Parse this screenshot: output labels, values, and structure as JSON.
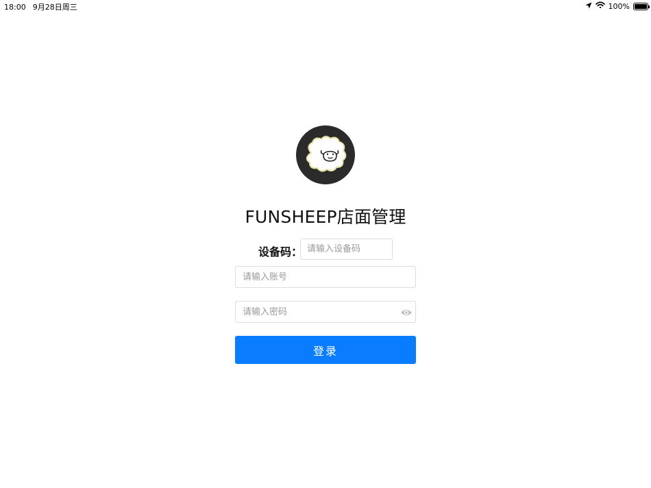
{
  "status_bar": {
    "time": "18:00",
    "date": "9月28日周三",
    "battery_text": "100%",
    "battery_level": 1.0,
    "icons": [
      "location-arrow-icon",
      "wifi-icon",
      "battery-icon"
    ]
  },
  "logo": {
    "icon": "sheep-logo-icon",
    "background_color": "#2b2b2b"
  },
  "title": "FUNSHEEP店面管理",
  "form": {
    "device_code_label": "设备码：",
    "device_code_placeholder": "请输入设备码",
    "device_code_value": "",
    "account_placeholder": "请输入账号",
    "account_value": "",
    "password_placeholder": "请输入密码",
    "password_value": "",
    "password_toggle_icon": "eye-icon",
    "login_label": "登录"
  },
  "colors": {
    "primary": "#0a7cff",
    "border": "#dcdcdc",
    "placeholder": "#9a9a9a"
  }
}
